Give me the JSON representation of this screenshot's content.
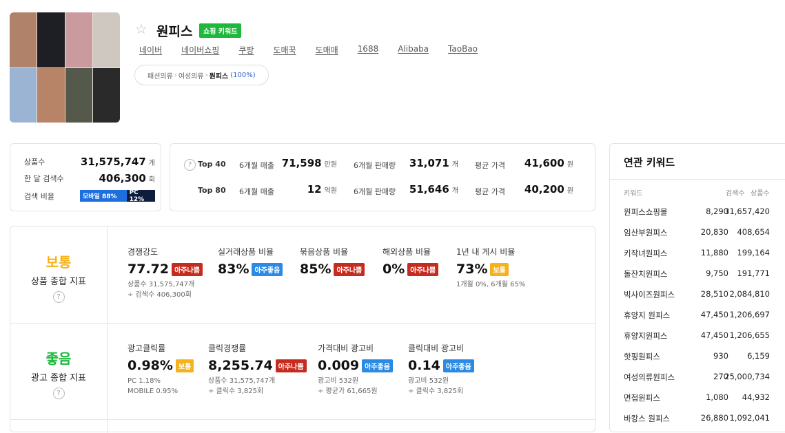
{
  "product": {
    "title": "원피스",
    "badge": "쇼핑 키워드",
    "links": [
      "네이버",
      "네이버쇼핑",
      "쿠팡",
      "도매꾹",
      "도매매",
      "1688",
      "Alibaba",
      "TaoBao"
    ],
    "category": {
      "level1": "패션의류",
      "level2": "여성의류",
      "current": "원피스",
      "percent": "(100%)"
    }
  },
  "summary": {
    "product_count_label": "상품수",
    "product_count": "31,575,747",
    "product_count_unit": "개",
    "monthly_search_label": "한 달 검색수",
    "monthly_search": "406,300",
    "monthly_search_unit": "회",
    "search_ratio_label": "검색 비율",
    "mobile": "모바일 88%",
    "pc": "PC 12%"
  },
  "top": {
    "rows": [
      {
        "rank": "Top 40",
        "sales_label": "6개월 매출",
        "sales": "71,598",
        "sales_unit": "만원",
        "qty_label": "6개월 판매량",
        "qty": "31,071",
        "qty_unit": "개",
        "price_label": "평균 가격",
        "price": "41,600",
        "price_unit": "원"
      },
      {
        "rank": "Top 80",
        "sales_label": "6개월 매출",
        "sales": "12",
        "sales_unit": "억원",
        "qty_label": "6개월 판매량",
        "qty": "51,646",
        "qty_unit": "개",
        "price_label": "평균 가격",
        "price": "40,200",
        "price_unit": "원"
      }
    ]
  },
  "product_index": {
    "grade": "보통",
    "grade_color": "#f6b21c",
    "label": "상품 종합 지표",
    "metrics": [
      {
        "label": "경쟁강도",
        "value": "77.72",
        "tag": "아주나쁨",
        "tag_type": "bad",
        "sub1": "상품수 31,575,747개",
        "sub2": "÷ 검색수 406,300회"
      },
      {
        "label": "실거래상품 비율",
        "value": "83%",
        "tag": "아주좋음",
        "tag_type": "good",
        "sub1": "",
        "sub2": ""
      },
      {
        "label": "묶음상품 비율",
        "value": "85%",
        "tag": "아주나쁨",
        "tag_type": "bad",
        "sub1": "",
        "sub2": ""
      },
      {
        "label": "해외상품 비율",
        "value": "0%",
        "tag": "아주나쁨",
        "tag_type": "bad",
        "sub1": "",
        "sub2": ""
      },
      {
        "label": "1년 내 게시 비율",
        "value": "73%",
        "tag": "보통",
        "tag_type": "mid",
        "sub1": "1개월 0%, 6개월 65%",
        "sub2": ""
      }
    ]
  },
  "ad_index": {
    "grade": "좋음",
    "grade_color": "#1fb83d",
    "label": "광고 종합 지표",
    "metrics": [
      {
        "label": "광고클릭률",
        "value": "0.98%",
        "tag": "보통",
        "tag_type": "mid",
        "sub1": "PC 1.18%",
        "sub2": "MOBILE 0.95%"
      },
      {
        "label": "클릭경쟁률",
        "value": "8,255.74",
        "tag": "아주나쁨",
        "tag_type": "bad",
        "sub1": "상품수 31,575,747개",
        "sub2": "÷ 클릭수 3,825회"
      },
      {
        "label": "가격대비 광고비",
        "value": "0.009",
        "tag": "아주좋음",
        "tag_type": "good",
        "sub1": "광고비 532원",
        "sub2": "÷ 평균가 61,665원"
      },
      {
        "label": "클릭대비 광고비",
        "value": "0.14",
        "tag": "아주좋음",
        "tag_type": "good",
        "sub1": "광고비 532원",
        "sub2": "÷ 클릭수 3,825회"
      }
    ]
  },
  "related": {
    "title": "연관 키워드",
    "headers": [
      "키워드",
      "검색수",
      "상품수"
    ],
    "rows": [
      [
        "원피스쇼핑몰",
        "8,290",
        "31,657,420"
      ],
      [
        "임산부원피스",
        "20,830",
        "408,654"
      ],
      [
        "키작녀원피스",
        "11,880",
        "199,164"
      ],
      [
        "돌잔치원피스",
        "9,750",
        "191,771"
      ],
      [
        "빅사이즈원피스",
        "28,510",
        "2,084,810"
      ],
      [
        "휴양지 원피스",
        "47,450",
        "1,206,697"
      ],
      [
        "휴양지원피스",
        "47,450",
        "1,206,655"
      ],
      [
        "핫핑원피스",
        "930",
        "6,159"
      ],
      [
        "여성의류원피스",
        "270",
        "25,000,734"
      ],
      [
        "면접원피스",
        "1,080",
        "44,932"
      ],
      [
        "바캉스 원피스",
        "26,880",
        "1,092,041"
      ]
    ]
  }
}
